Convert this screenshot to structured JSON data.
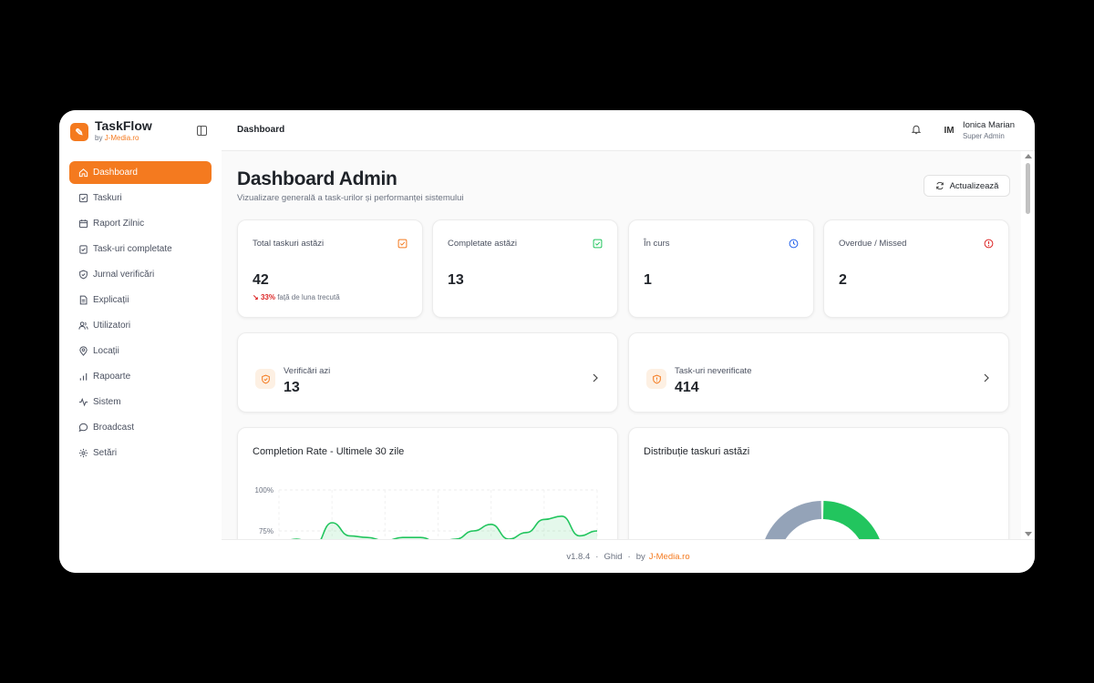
{
  "brand": {
    "name": "TaskFlow",
    "by": "by",
    "by_link": "J-Media.ro"
  },
  "sidebar": {
    "items": [
      {
        "label": "Dashboard",
        "icon": "home-icon"
      },
      {
        "label": "Taskuri",
        "icon": "checkbox-icon"
      },
      {
        "label": "Raport Zilnic",
        "icon": "calendar-icon"
      },
      {
        "label": "Task-uri completate",
        "icon": "clipboard-check-icon"
      },
      {
        "label": "Jurnal verificări",
        "icon": "shield-check-icon"
      },
      {
        "label": "Explicații",
        "icon": "document-icon"
      },
      {
        "label": "Utilizatori",
        "icon": "users-icon"
      },
      {
        "label": "Locații",
        "icon": "map-pin-icon"
      },
      {
        "label": "Rapoarte",
        "icon": "bar-chart-icon"
      },
      {
        "label": "Sistem",
        "icon": "activity-icon"
      },
      {
        "label": "Broadcast",
        "icon": "message-icon"
      },
      {
        "label": "Setări",
        "icon": "gear-icon"
      }
    ]
  },
  "header": {
    "breadcrumb": "Dashboard",
    "user": {
      "initials": "IM",
      "name": "Ionica Marian",
      "role": "Super Admin"
    }
  },
  "page": {
    "title": "Dashboard Admin",
    "subtitle": "Vizualizare generală a task-urilor și performanței sistemului",
    "refresh_label": "Actualizează"
  },
  "stats": [
    {
      "label": "Total taskuri astăzi",
      "value": "42",
      "trend_pct": "33%",
      "trend_text": "față de luna trecută",
      "color": "#f47a1f"
    },
    {
      "label": "Completate astăzi",
      "value": "13",
      "color": "#22c55e"
    },
    {
      "label": "În curs",
      "value": "1",
      "color": "#2563eb"
    },
    {
      "label": "Overdue / Missed",
      "value": "2",
      "color": "#dc2626"
    }
  ],
  "verify": [
    {
      "label": "Verificări azi",
      "value": "13"
    },
    {
      "label": "Task-uri neverificate",
      "value": "414"
    }
  ],
  "charts": {
    "completion_title": "Completion Rate - Ultimele 30 zile",
    "distribution_title": "Distribuție taskuri astăzi"
  },
  "chart_data": [
    {
      "type": "area",
      "title": "Completion Rate - Ultimele 30 zile",
      "y_tick_labels": [
        "100%",
        "75%"
      ],
      "ylim": [
        0,
        100
      ],
      "color": "#22c55e",
      "points": [
        [
          0,
          68
        ],
        [
          1,
          70
        ],
        [
          2,
          66
        ],
        [
          3,
          80
        ],
        [
          4,
          72
        ],
        [
          5,
          71
        ],
        [
          6,
          69
        ],
        [
          7,
          71
        ],
        [
          8,
          71
        ],
        [
          9,
          68
        ],
        [
          10,
          70
        ],
        [
          11,
          75
        ],
        [
          12,
          79
        ],
        [
          13,
          70
        ],
        [
          14,
          74
        ],
        [
          15,
          82
        ],
        [
          16,
          84
        ],
        [
          17,
          72
        ],
        [
          18,
          75
        ]
      ]
    },
    {
      "type": "pie",
      "title": "Distribuție taskuri astăzi",
      "slices": [
        {
          "value": 13,
          "color": "#22c55e"
        },
        {
          "value": 1,
          "color": "#3b82f6"
        },
        {
          "value": 28,
          "color": "#94a3b8"
        }
      ]
    }
  ],
  "footer": {
    "version": "v1.8.4",
    "sep": "·",
    "guide": "Ghid",
    "by": "by",
    "link": "J-Media.ro"
  }
}
